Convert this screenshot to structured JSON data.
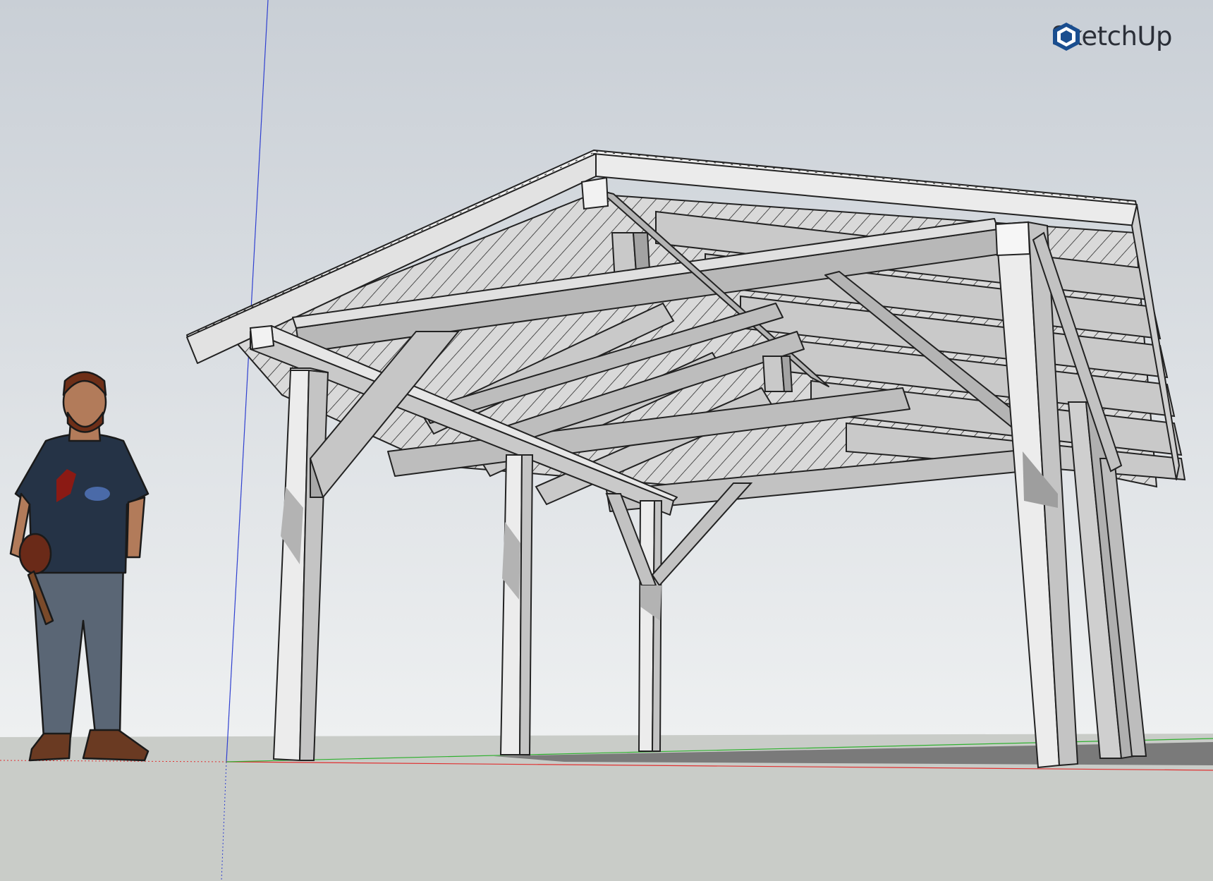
{
  "app": {
    "brand_name": "SketchUp"
  },
  "colors": {
    "sky_top": "#c9cfd6",
    "sky_bottom": "#eef0f1",
    "ground": "#c9ccc8",
    "face_light": "#eeeeee",
    "face_mid": "#c9c9c9",
    "face_dark": "#a3a3a3",
    "brand": "#1a4e8f",
    "axis_red": "#e03030",
    "axis_green": "#30b030",
    "axis_blue": "#3040d0"
  },
  "scene": {
    "model_description_icon": "pavilion-model",
    "scale_figure_icon": "person-figure"
  }
}
